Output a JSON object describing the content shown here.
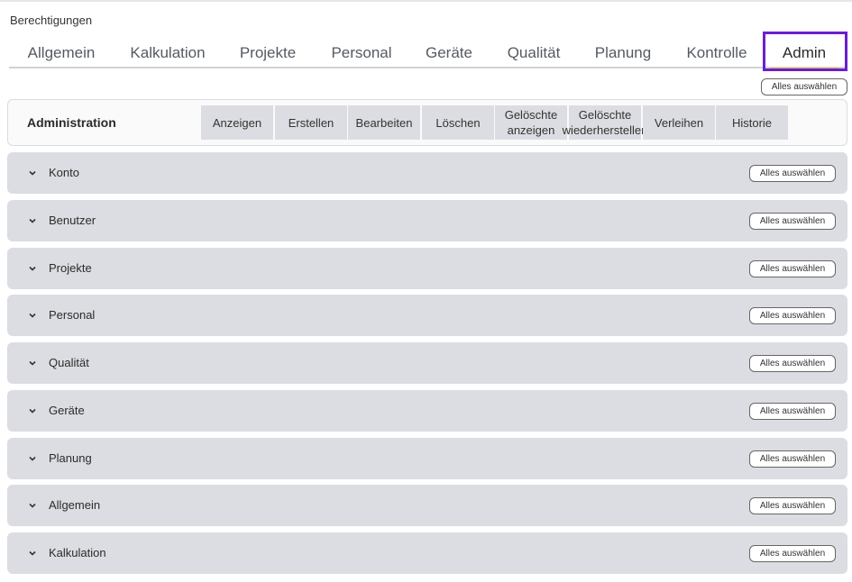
{
  "page": {
    "title": "Berechtigungen"
  },
  "tabs": [
    {
      "label": "Allgemein",
      "active": false
    },
    {
      "label": "Kalkulation",
      "active": false
    },
    {
      "label": "Projekte",
      "active": false
    },
    {
      "label": "Personal",
      "active": false
    },
    {
      "label": "Geräte",
      "active": false
    },
    {
      "label": "Qualität",
      "active": false
    },
    {
      "label": "Planung",
      "active": false
    },
    {
      "label": "Kontrolle",
      "active": false
    },
    {
      "label": "Admin",
      "active": true
    }
  ],
  "select_all_label": "Alles auswählen",
  "header": {
    "title": "Administration",
    "columns": [
      {
        "label": "Anzeigen"
      },
      {
        "label": "Erstellen"
      },
      {
        "label": "Bearbeiten"
      },
      {
        "label": "Löschen"
      },
      {
        "label": "Gelöschte\nanzeigen"
      },
      {
        "label": "Gelöschte\nwiederherstellen"
      },
      {
        "label": "Verleihen"
      },
      {
        "label": "Historie"
      }
    ]
  },
  "sections": [
    {
      "label": "Konto",
      "icon": "chevron-down-icon"
    },
    {
      "label": "Benutzer",
      "icon": "chevron-down-icon"
    },
    {
      "label": "Projekte",
      "icon": "chevron-down-icon"
    },
    {
      "label": "Personal",
      "icon": "chevron-down-icon"
    },
    {
      "label": "Qualität",
      "icon": "chevron-down-icon"
    },
    {
      "label": "Geräte",
      "icon": "chevron-down-icon"
    },
    {
      "label": "Planung",
      "icon": "chevron-down-icon"
    },
    {
      "label": "Allgemein",
      "icon": "chevron-down-icon"
    },
    {
      "label": "Kalkulation",
      "icon": "chevron-down-icon"
    }
  ],
  "colors": {
    "accent": "#f2c230",
    "highlight": "#6a1fd1",
    "section_bg": "#dcdde2"
  }
}
